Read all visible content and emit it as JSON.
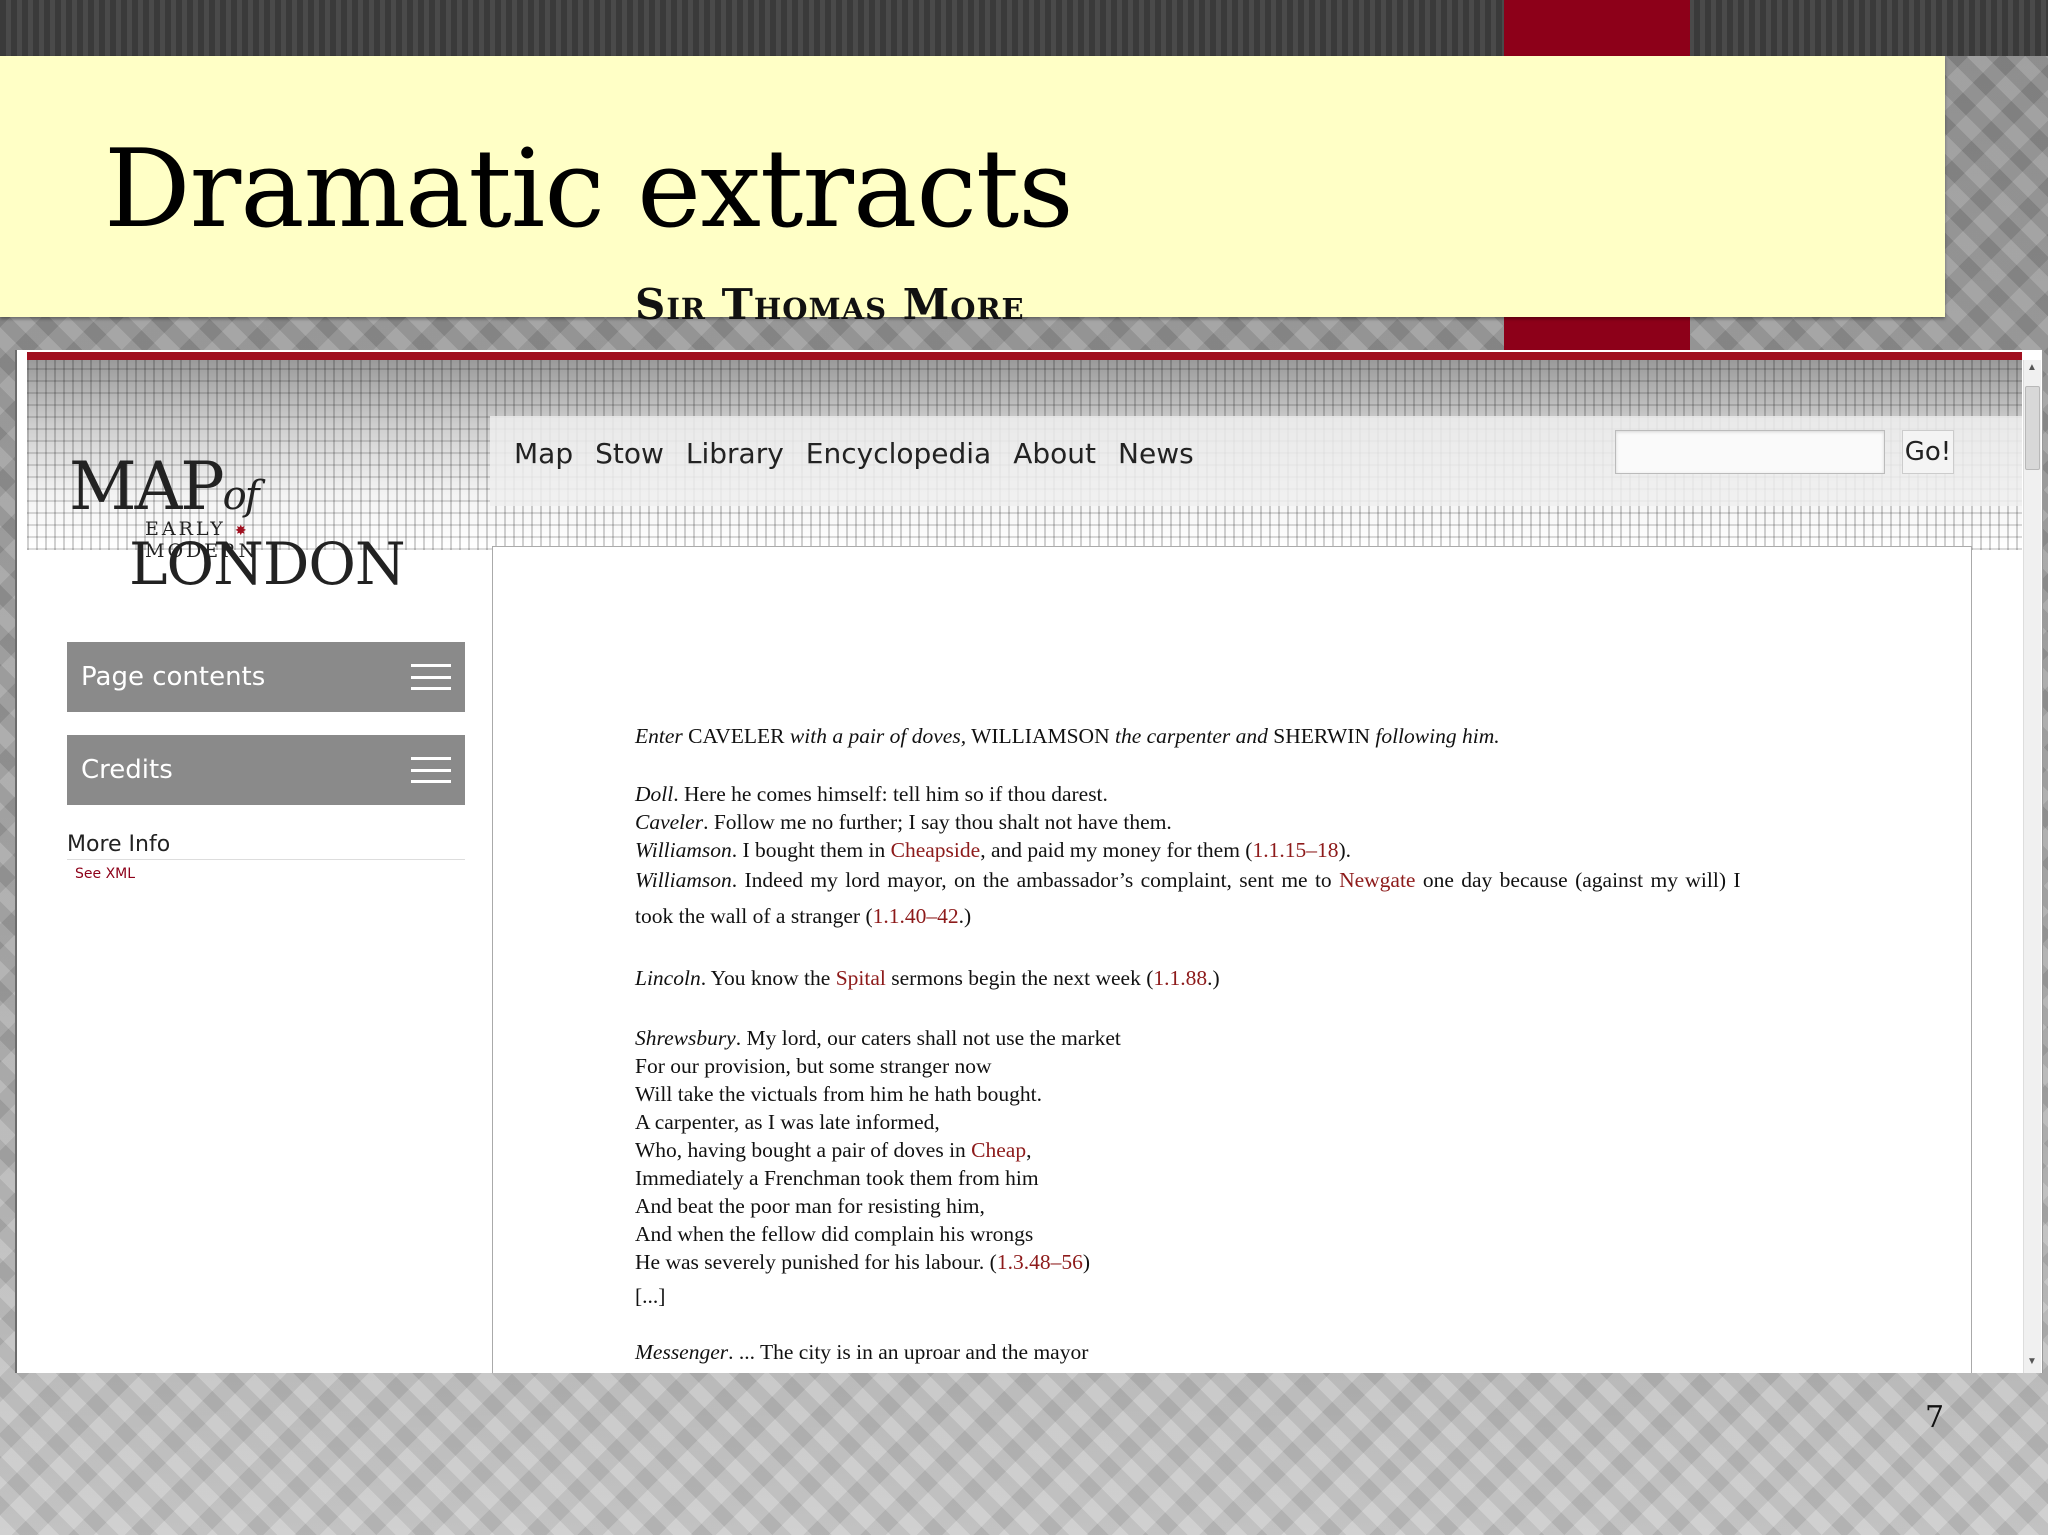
{
  "slide": {
    "title": "Dramatic extracts",
    "number": "7"
  },
  "colors": {
    "accent_red": "#8d0019",
    "title_bg": "#ffffc6",
    "link": "#8d1a1a"
  },
  "logo": {
    "line1": "MAP",
    "of": "of",
    "line2": "EARLY MODERN",
    "line3": "LONDON",
    "star": "✸"
  },
  "nav": {
    "items": [
      "Map",
      "Stow",
      "Library",
      "Encyclopedia",
      "About",
      "News"
    ],
    "search_placeholder": "",
    "go_label": "Go!"
  },
  "sidebar": {
    "page_contents": "Page contents",
    "credits": "Credits",
    "more_info": "More Info",
    "see_xml": "See XML"
  },
  "content": {
    "title": "Sir Thomas More",
    "stage_direction": {
      "a": "Enter",
      "b": " CAVELER ",
      "c": "with a pair of doves,",
      "d": " WILLIAMSON ",
      "e": "the carpenter and",
      "f": " SHERWIN ",
      "g": "following him."
    },
    "lines": [
      {
        "speaker": "Doll",
        "text": ". Here he comes himself: tell him so if thou darest."
      },
      {
        "speaker": "Caveler",
        "text": ". Follow me no further; I say thou shalt not have them."
      },
      {
        "speaker": "Williamson",
        "pre": ". I bought them in ",
        "link": "Cheapside",
        "post": ", and paid my money for them (",
        "ref": "1.1.15–18",
        "end": ")."
      },
      {
        "speaker": "Williamson",
        "pre": ". Indeed my lord mayor, on the ambassador’s complaint, sent me to ",
        "link": "Newgate",
        "post": " one day because (against my will) I"
      },
      {
        "pre": "took the wall of a stranger (",
        "ref": "1.1.40–42",
        "end": ".)"
      },
      {
        "speaker": "Lincoln",
        "pre": ". You know the ",
        "link": "Spital",
        "post": " sermons begin the next week (",
        "ref": "1.1.88",
        "end": ".)"
      },
      {
        "speaker": "Shrewsbury",
        "text": ". My lord, our caters shall not use the market"
      }
    ],
    "verse": [
      "For our provision, but some stranger now",
      "Will take the victuals from him he hath bought.",
      "A carpenter, as I was late informed,"
    ],
    "verse_cheap": {
      "pre": "Who, having bought a pair of doves in ",
      "link": "Cheap",
      "post": ","
    },
    "verse2": [
      "Immediately a Frenchman took them from him",
      "And beat the poor man for resisting him,",
      "And when the fellow did complain his wrongs"
    ],
    "verse_end": {
      "pre": "He was severely punished for his labour. (",
      "ref": "1.3.48–56",
      "end": ")"
    },
    "ellipsis": "[...]",
    "messenger": {
      "speaker": "Messenger",
      "text": ". ... The city is in an uproar and the mayor"
    }
  }
}
